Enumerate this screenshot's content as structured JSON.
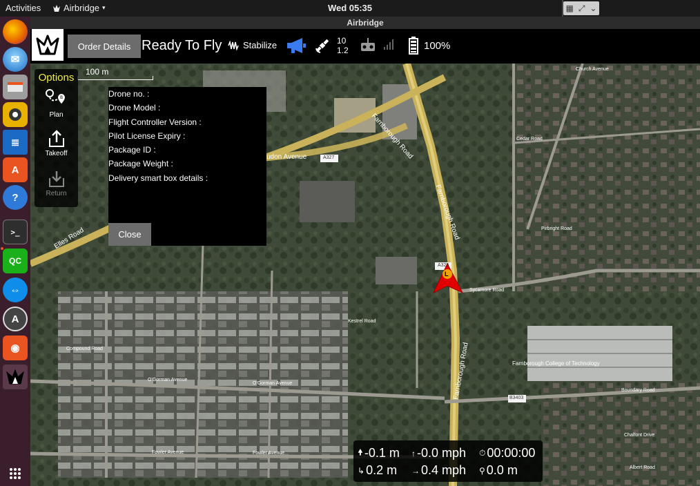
{
  "topbar": {
    "activities": "Activities",
    "app_name": "Airbridge",
    "clock": "Wed 05:35"
  },
  "window": {
    "title": "Airbridge"
  },
  "dock": {
    "items": [
      {
        "name": "firefox",
        "color": "#e66000"
      },
      {
        "name": "thunderbird",
        "color": "#1f6fc5"
      },
      {
        "name": "files",
        "color": "#b0b0b0"
      },
      {
        "name": "rhythmbox",
        "color": "#e8b100"
      },
      {
        "name": "libreoffice-writer",
        "color": "#1b6ac4"
      },
      {
        "name": "software-center",
        "color": "#e95420"
      },
      {
        "name": "help",
        "color": "#2f7ad9"
      },
      {
        "name": "terminal",
        "color": "#2e2e2e"
      },
      {
        "name": "qgroundcontrol",
        "color": "#19b019"
      },
      {
        "name": "teamviewer",
        "color": "#0e8ee9"
      },
      {
        "name": "software-updater",
        "color": "#555555"
      },
      {
        "name": "screenshot-tool",
        "color": "#e95420"
      },
      {
        "name": "airbridge",
        "color": "#000000"
      }
    ],
    "grid_label": "⋮⋮⋮"
  },
  "toolbar": {
    "order_details_label": "Order Details",
    "status": "Ready To Fly",
    "flight_mode": "Stabilize",
    "satellite_count": "10",
    "hdop": "1.2",
    "battery": "100%"
  },
  "map": {
    "scale": "100 m",
    "labels": {
      "farnborough_road": "Farnborough Road",
      "elles_road": "Elles Road",
      "college": "Farnborough College of Technology",
      "sycamore": "Sycamore Road",
      "boundary": "Boundary Road",
      "fowler": "Fowler Avenue",
      "ogorman": "O'Gorman Avenue",
      "church": "Church Avenue",
      "cedar": "Cedar Road",
      "pirbright": "Pirbright Road",
      "compound": "Compound Road",
      "kestrel": "Kestrel Road",
      "chalfont": "Chalfont Drive",
      "albert": "Albert Road",
      "a327": "A327",
      "a325": "A325",
      "b3403": "B3403",
      "avenue": "udon Avenue"
    },
    "vehicle_label": "L"
  },
  "options": {
    "title": "Options",
    "items": [
      {
        "label": "Plan"
      },
      {
        "label": "Takeoff"
      },
      {
        "label": "Return"
      }
    ]
  },
  "order_details": {
    "fields": [
      "Drone no. :",
      "Drone Model :",
      "Flight Controller Version  :",
      "Pilot License Expiry :",
      "Package ID  :",
      "Package Weight :",
      "Delivery smart box details :"
    ],
    "close_label": "Close"
  },
  "telemetry": {
    "altitude": "-0.1 m",
    "vertical_speed": "-0.0 mph",
    "flight_time": "00:00:00",
    "distance": "0.2 m",
    "ground_speed": "0.4 mph",
    "home_distance": "0.0 m"
  }
}
